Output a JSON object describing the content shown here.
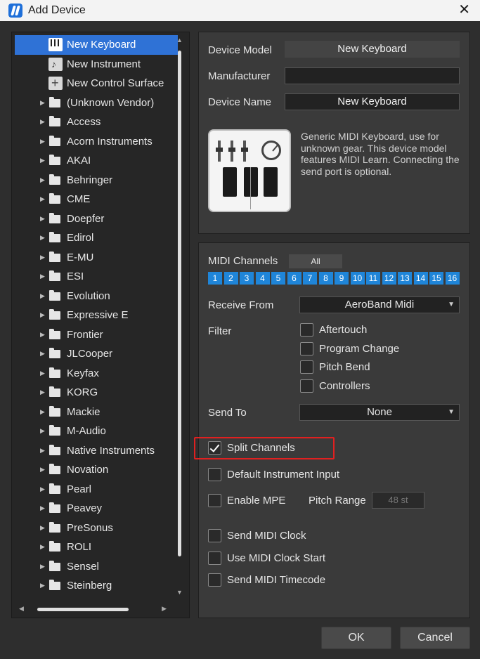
{
  "window": {
    "title": "Add Device",
    "close_glyph": "✕"
  },
  "tree": {
    "items": [
      {
        "label": "New Keyboard",
        "type": "device",
        "icon": "keyboard-icon",
        "selected": true
      },
      {
        "label": "New Instrument",
        "type": "device",
        "icon": "instrument-icon"
      },
      {
        "label": "New Control Surface",
        "type": "device",
        "icon": "control-surface-icon"
      },
      {
        "label": "(Unknown Vendor)",
        "type": "folder"
      },
      {
        "label": "Access",
        "type": "folder"
      },
      {
        "label": "Acorn Instruments",
        "type": "folder"
      },
      {
        "label": "AKAI",
        "type": "folder"
      },
      {
        "label": "Behringer",
        "type": "folder"
      },
      {
        "label": "CME",
        "type": "folder"
      },
      {
        "label": "Doepfer",
        "type": "folder"
      },
      {
        "label": "Edirol",
        "type": "folder"
      },
      {
        "label": "E-MU",
        "type": "folder"
      },
      {
        "label": "ESI",
        "type": "folder"
      },
      {
        "label": "Evolution",
        "type": "folder"
      },
      {
        "label": "Expressive E",
        "type": "folder"
      },
      {
        "label": "Frontier",
        "type": "folder"
      },
      {
        "label": "JLCooper",
        "type": "folder"
      },
      {
        "label": "Keyfax",
        "type": "folder"
      },
      {
        "label": "KORG",
        "type": "folder"
      },
      {
        "label": "Mackie",
        "type": "folder"
      },
      {
        "label": "M-Audio",
        "type": "folder"
      },
      {
        "label": "Native Instruments",
        "type": "folder"
      },
      {
        "label": "Novation",
        "type": "folder"
      },
      {
        "label": "Pearl",
        "type": "folder"
      },
      {
        "label": "Peavey",
        "type": "folder"
      },
      {
        "label": "PreSonus",
        "type": "folder"
      },
      {
        "label": "ROLI",
        "type": "folder"
      },
      {
        "label": "Sensel",
        "type": "folder"
      },
      {
        "label": "Steinberg",
        "type": "folder"
      }
    ]
  },
  "device": {
    "model_label": "Device Model",
    "model_value": "New Keyboard",
    "manufacturer_label": "Manufacturer",
    "manufacturer_value": "",
    "name_label": "Device Name",
    "name_value": "New Keyboard",
    "description": "Generic MIDI Keyboard, use for unknown gear. This device model features MIDI Learn. Connecting the send port is optional."
  },
  "midi": {
    "channels_label": "MIDI Channels",
    "all_label": "All",
    "channels": [
      "1",
      "2",
      "3",
      "4",
      "5",
      "6",
      "7",
      "8",
      "9",
      "10",
      "11",
      "12",
      "13",
      "14",
      "15",
      "16"
    ],
    "receive_label": "Receive From",
    "receive_value": "AeroBand Midi",
    "filter_label": "Filter",
    "filters": [
      {
        "label": "Aftertouch",
        "checked": false
      },
      {
        "label": "Program Change",
        "checked": false
      },
      {
        "label": "Pitch Bend",
        "checked": false
      },
      {
        "label": "Controllers",
        "checked": false
      }
    ],
    "send_label": "Send To",
    "send_value": "None",
    "split_channels": {
      "label": "Split Channels",
      "checked": true
    },
    "default_input": {
      "label": "Default Instrument Input",
      "checked": false
    },
    "enable_mpe": {
      "label": "Enable MPE",
      "checked": false
    },
    "pitch_range_label": "Pitch Range",
    "pitch_range_value": "48 st",
    "send_clock": {
      "label": "Send MIDI Clock",
      "checked": false
    },
    "clock_start": {
      "label": "Use MIDI Clock Start",
      "checked": false
    },
    "send_timecode": {
      "label": "Send MIDI Timecode",
      "checked": false
    }
  },
  "buttons": {
    "ok": "OK",
    "cancel": "Cancel"
  },
  "colors": {
    "selection": "#2f72d6",
    "channel": "#1f85d8",
    "highlight": "#e02020"
  }
}
